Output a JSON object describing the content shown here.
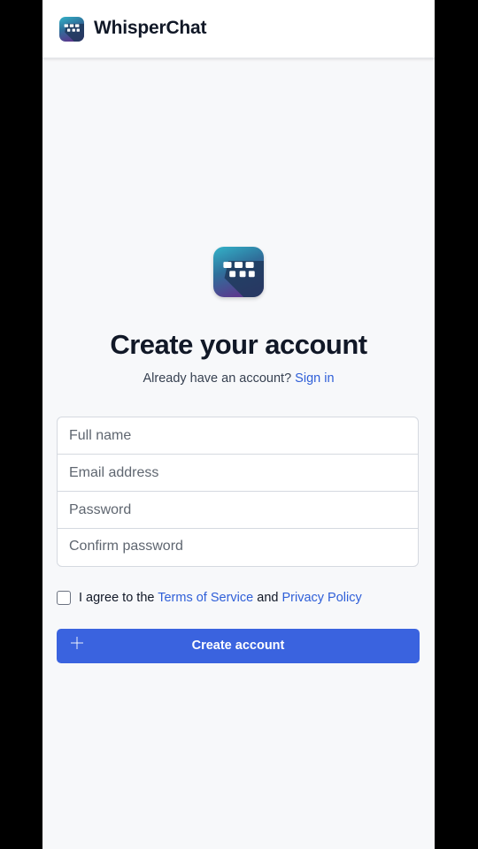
{
  "app": {
    "name": "WhisperChat",
    "logo_icon": "whisperchat-logo-icon",
    "colors": {
      "accent": "#3a63df",
      "link": "#2f5fd8",
      "logo_gradient": [
        "#2fa9c3",
        "#25476f",
        "#5b3c8f"
      ]
    }
  },
  "signup": {
    "title": "Create your account",
    "subtitle_prefix": "Already have an account?",
    "sign_in_link": "Sign in",
    "fields": {
      "full_name": {
        "placeholder": "Full name",
        "value": ""
      },
      "email": {
        "placeholder": "Email address",
        "value": ""
      },
      "password": {
        "placeholder": "Password",
        "value": ""
      },
      "confirm_password": {
        "placeholder": "Confirm password",
        "value": ""
      }
    },
    "agree": {
      "checked": false,
      "prefix": "I agree to the",
      "terms_link": "Terms of Service",
      "conjunction": "and",
      "privacy_link": "Privacy Policy"
    },
    "submit": {
      "label": "Create account",
      "icon": "plus-icon"
    }
  }
}
